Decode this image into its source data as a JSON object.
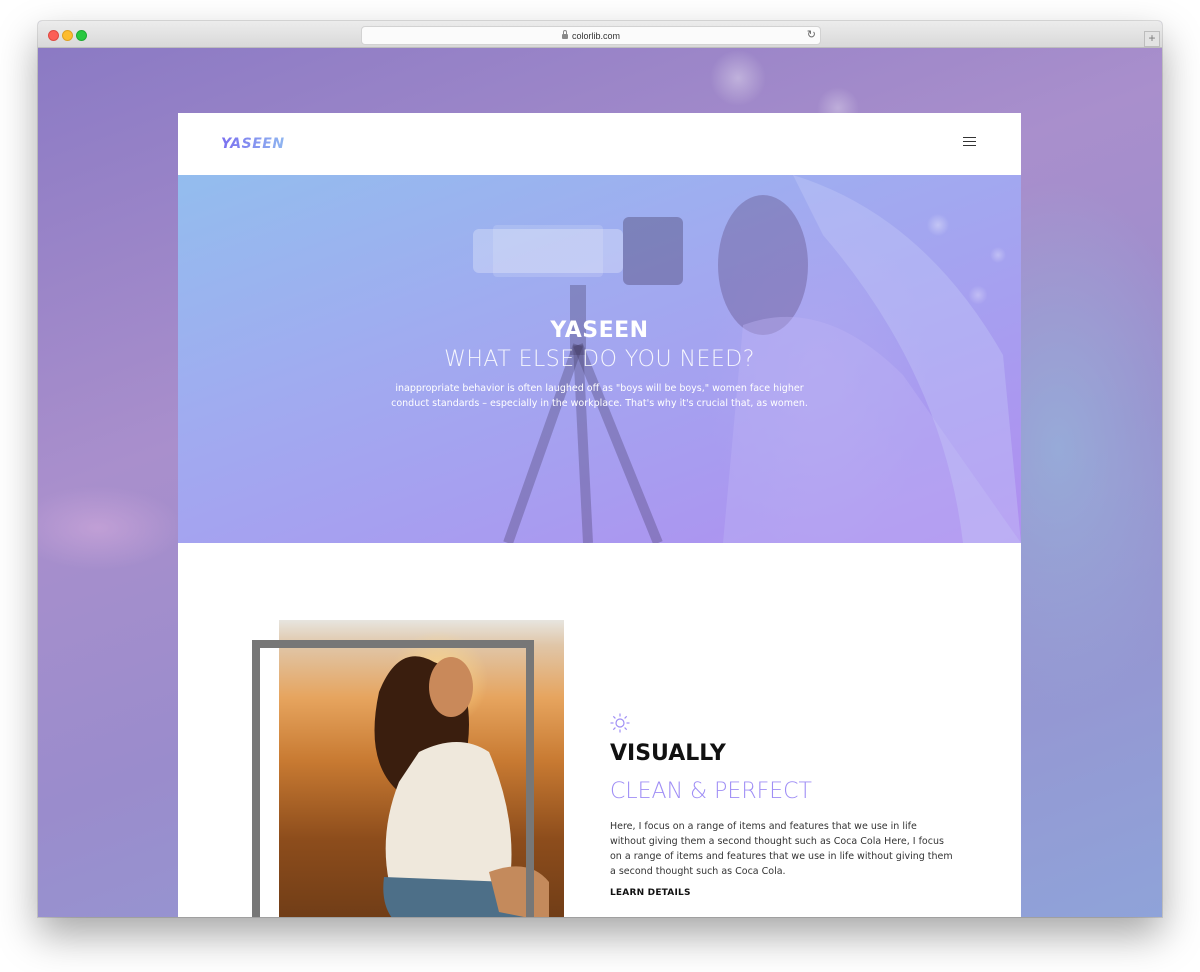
{
  "browser": {
    "url": "colorlib.com"
  },
  "site": {
    "logo": "YASEEN"
  },
  "hero": {
    "title": "YASEEN",
    "subtitle": "WHAT ELSE DO YOU NEED?",
    "text": "inappropriate behavior is often laughed off as \"boys will be boys,\" women face higher conduct standards – especially in the workplace. That's why it's crucial that, as women."
  },
  "feature": {
    "icon": "sun-icon",
    "title": "VISUALLY",
    "subtitle": "CLEAN & PERFECT",
    "text": "Here, I focus on a range of items and features that we use in life without giving them a second thought such as Coca Cola Here, I focus on a range of items and features that we use in life without giving them a second thought such as Coca Cola.",
    "link_label": "LEARN DETAILS"
  },
  "colors": {
    "accent": "#9f8ef5",
    "hero_gradient_start": "#93bdee",
    "hero_gradient_end": "#b08ef0"
  }
}
